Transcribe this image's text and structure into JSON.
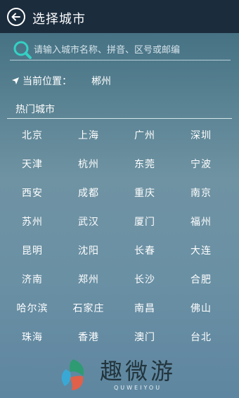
{
  "header": {
    "back_icon": "back-arrow-icon",
    "title": "选择城市"
  },
  "search": {
    "icon": "search-icon",
    "value": "",
    "placeholder": "请输入城市名称、拼音、区号或邮编"
  },
  "location": {
    "icon": "location-arrow-icon",
    "label": "当前位置：",
    "city": "郴州"
  },
  "hot": {
    "label": "热门城市",
    "cities": [
      "北京",
      "上海",
      "广州",
      "深圳",
      "天津",
      "杭州",
      "东莞",
      "宁波",
      "西安",
      "成都",
      "重庆",
      "南京",
      "苏州",
      "武汉",
      "厦门",
      "福州",
      "昆明",
      "沈阳",
      "长春",
      "大连",
      "济南",
      "郑州",
      "长沙",
      "合肥",
      "哈尔滨",
      "石家庄",
      "南昌",
      "佛山",
      "珠海",
      "香港",
      "澳门",
      "台北"
    ]
  },
  "watermark": {
    "logo_icon": "quweiyou-logo-icon",
    "main": "趣微游",
    "sub": "QUWEIYOU"
  },
  "colors": {
    "header_bg": "#1b2c3d",
    "search_icon": "#34d1c4",
    "text": "#ffffff"
  }
}
